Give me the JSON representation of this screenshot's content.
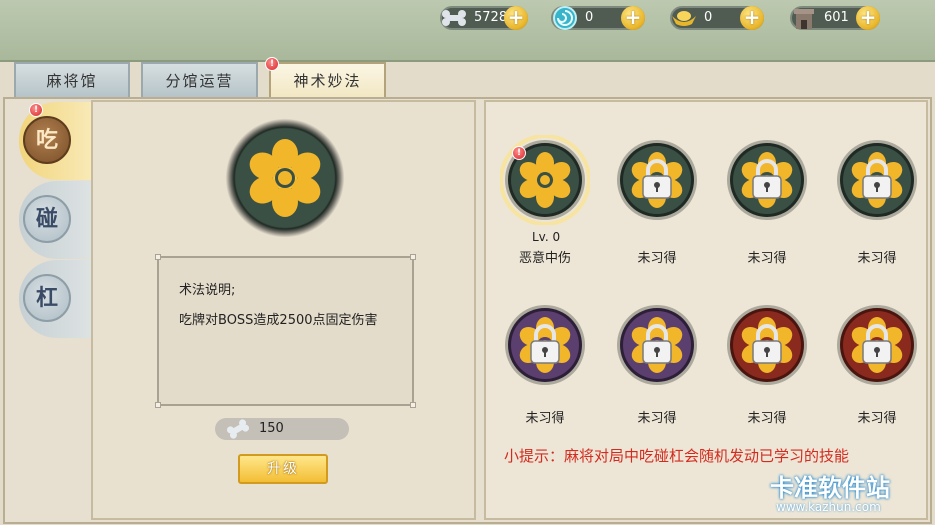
{
  "resources": [
    {
      "icon": "bone-icon",
      "value": "5728"
    },
    {
      "icon": "jade-swirl-icon",
      "value": "0"
    },
    {
      "icon": "gold-ingot-icon",
      "value": "0"
    },
    {
      "icon": "building-icon",
      "value": "601"
    }
  ],
  "tabs": [
    {
      "label": "麻将馆"
    },
    {
      "label": "分馆运营"
    },
    {
      "label": "神术妙法"
    }
  ],
  "side_tabs": [
    {
      "label": "吃"
    },
    {
      "label": "碰"
    },
    {
      "label": "杠"
    }
  ],
  "selected_skill": {
    "desc_title": "术法说明;",
    "desc_text": "吃牌对BOSS造成2500点固定伤害",
    "cost": "150",
    "upgrade_label": "升级"
  },
  "skills": [
    {
      "level": "Lv. 0",
      "name": "恶意中伤",
      "locked": false,
      "theme": "dark-green"
    },
    {
      "name": "未习得",
      "locked": true,
      "theme": "dark-green"
    },
    {
      "name": "未习得",
      "locked": true,
      "theme": "dark-green"
    },
    {
      "name": "未习得",
      "locked": true,
      "theme": "dark-green"
    },
    {
      "name": "未习得",
      "locked": true,
      "theme": "purple"
    },
    {
      "name": "未习得",
      "locked": true,
      "theme": "purple"
    },
    {
      "name": "未习得",
      "locked": true,
      "theme": "red"
    },
    {
      "name": "未习得",
      "locked": true,
      "theme": "red"
    }
  ],
  "hint": "小提示：麻将对局中吃碰杠会随机发动已学习的技能",
  "watermark": {
    "text": "卡准软件站",
    "url": "www.kazhun.com"
  },
  "colors": {
    "accent_gold": "#f3be35",
    "hint_red": "#d32b1f"
  }
}
